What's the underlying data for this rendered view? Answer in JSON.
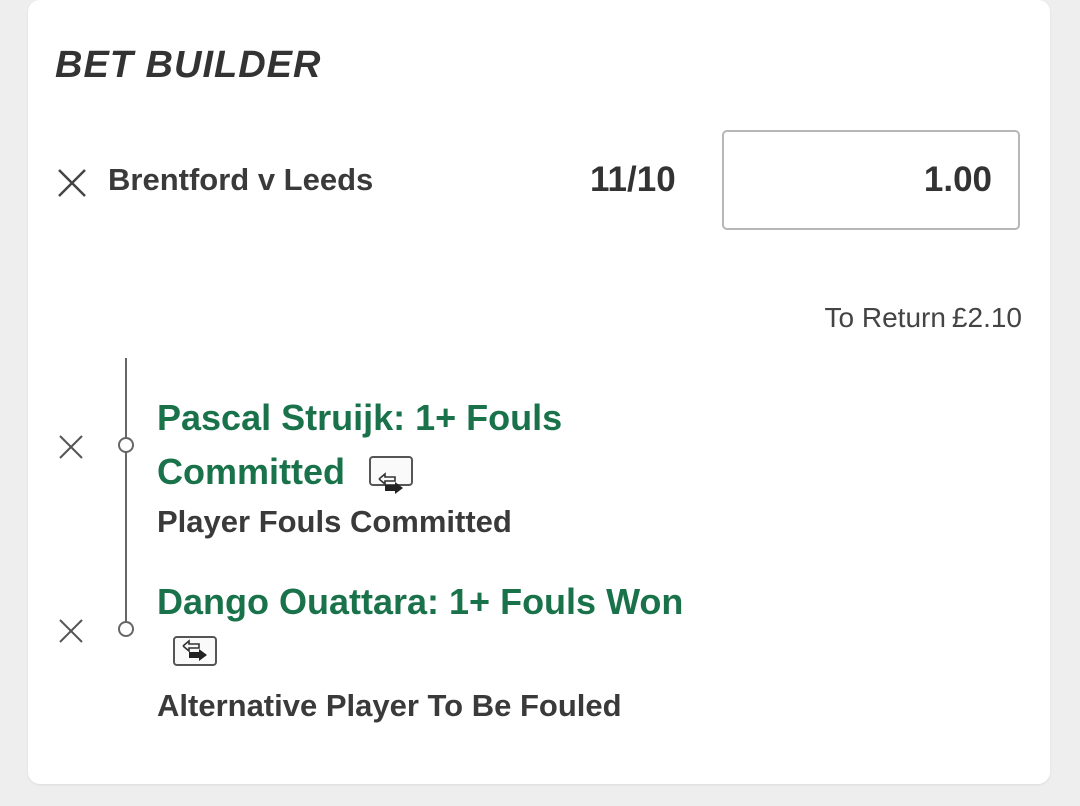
{
  "header": {
    "title": "BET BUILDER"
  },
  "bet": {
    "event": "Brentford v Leeds",
    "odds": "11/10",
    "stake": "1.00",
    "to_return_label": "To Return",
    "to_return_value": "£2.10"
  },
  "selections": [
    {
      "title_line1": "Pascal Struijk: 1+ Fouls",
      "title_line2": "Committed",
      "market": "Player Fouls Committed",
      "icon": "swap-icon"
    },
    {
      "title_line1": "Dango Ouattara: 1+ Fouls Won",
      "market": "Alternative Player To Be Fouled",
      "icon": "swap-icon"
    }
  ],
  "colors": {
    "selection_text": "#19724a",
    "heading_text": "#333333",
    "background": "#eeeeee",
    "card": "#ffffff"
  }
}
